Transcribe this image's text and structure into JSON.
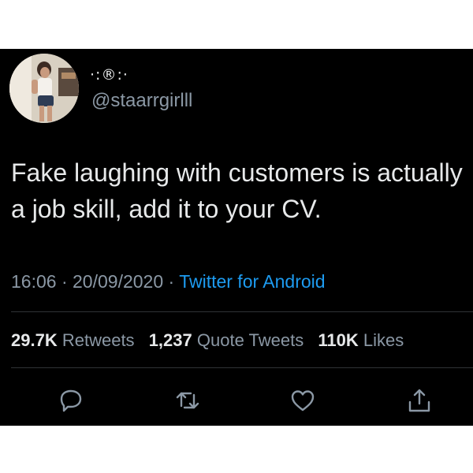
{
  "tweet": {
    "display_name": "·:®:·",
    "handle": "@staarrgirlll",
    "text": "Fake laughing with customers is actually a job skill, add it to your CV.",
    "time": "16:06",
    "date": "20/09/2020",
    "separator": "·",
    "source": "Twitter for Android"
  },
  "stats": {
    "retweets_count": "29.7K",
    "retweets_label": "Retweets",
    "quotes_count": "1,237",
    "quotes_label": "Quote Tweets",
    "likes_count": "110K",
    "likes_label": "Likes"
  },
  "actions": {
    "icons": [
      "reply-icon",
      "retweet-icon",
      "like-icon",
      "share-icon"
    ]
  },
  "colors": {
    "background": "#000000",
    "text": "#e7e9ea",
    "secondary": "#8b98a5",
    "link": "#1d9bf0"
  }
}
